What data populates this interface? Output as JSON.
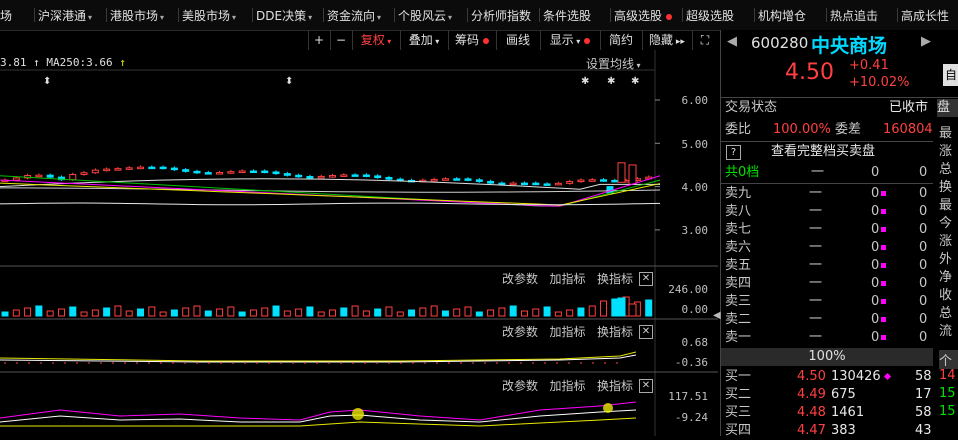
{
  "menu": [
    {
      "label": "场"
    },
    {
      "label": "沪深港通",
      "dropdown": true
    },
    {
      "label": "港股市场",
      "dropdown": true
    },
    {
      "label": "美股市场",
      "dropdown": true
    },
    {
      "label": "DDE决策",
      "dropdown": true
    },
    {
      "label": "资金流向",
      "dropdown": true
    },
    {
      "label": "个股风云",
      "dropdown": true
    },
    {
      "label": "分析师指数"
    },
    {
      "label": "条件选股"
    },
    {
      "label": "高级选股",
      "badge": true
    },
    {
      "label": "超级选股"
    },
    {
      "label": "机构增仓"
    },
    {
      "label": "热点追击"
    },
    {
      "label": "高成长性"
    }
  ],
  "toolbar": {
    "plus": "+",
    "minus": "−",
    "fuquan": "复权",
    "diejia": "叠加",
    "chouma": "筹码",
    "huaxian": "画线",
    "xianshi": "显示",
    "jianyue": "简约",
    "yincang": "隐藏",
    "expand": "⛶"
  },
  "ma_legend": {
    "ma_prefix": "3.81",
    "ma250": "MA250:3.66"
  },
  "settings_label": "设置均线",
  "price_axis": [
    "6.00",
    "5.00",
    "4.00",
    "3.00"
  ],
  "panel_tools": {
    "param": "改参数",
    "add": "加指标",
    "swap": "换指标",
    "close": "✕"
  },
  "panel_axes": [
    {
      "top": "246.00",
      "bottom": "0.00"
    },
    {
      "top": "0.68",
      "bottom": "-0.36"
    },
    {
      "top": "117.51",
      "bottom": "-9.24"
    }
  ],
  "stock": {
    "code": "600280",
    "name": "中央商场",
    "price": "4.50",
    "change": "+0.41",
    "change_pct": "+10.02%",
    "side_btn": "自"
  },
  "status": {
    "label": "交易状态",
    "value": "已收市",
    "tab": "盘口"
  },
  "ratio": {
    "wb_label": "委比",
    "wb": "100.00%",
    "wc_label": "委差",
    "wc": "160804"
  },
  "full_book": "查看完整档买卖盘",
  "total_row": {
    "label": "共0档",
    "dash": "一",
    "a": "0",
    "b": "0"
  },
  "sells": [
    {
      "label": "卖九",
      "price": "一",
      "vol": "0",
      "n": "0"
    },
    {
      "label": "卖八",
      "price": "一",
      "vol": "0",
      "n": "0"
    },
    {
      "label": "卖七",
      "price": "一",
      "vol": "0",
      "n": "0"
    },
    {
      "label": "卖六",
      "price": "一",
      "vol": "0",
      "n": "0"
    },
    {
      "label": "卖五",
      "price": "一",
      "vol": "0",
      "n": "0"
    },
    {
      "label": "卖四",
      "price": "一",
      "vol": "0",
      "n": "0"
    },
    {
      "label": "卖三",
      "price": "一",
      "vol": "0",
      "n": "0"
    },
    {
      "label": "卖二",
      "price": "一",
      "vol": "0",
      "n": "0"
    },
    {
      "label": "卖一",
      "price": "一",
      "vol": "0",
      "n": "0"
    }
  ],
  "mid_pct": "100%",
  "buys": [
    {
      "label": "买一",
      "price": "4.50",
      "vol": "130426",
      "n": "58"
    },
    {
      "label": "买二",
      "price": "4.49",
      "vol": "675",
      "n": "17"
    },
    {
      "label": "买三",
      "price": "4.48",
      "vol": "1461",
      "n": "58"
    },
    {
      "label": "买四",
      "price": "4.47",
      "vol": "383",
      "n": "43"
    }
  ],
  "tabcol": [
    "最",
    "涨",
    "总",
    "换",
    "最",
    "今",
    "涨",
    "外",
    "净",
    "收",
    "总",
    "流"
  ],
  "tabcol_bottom": {
    "label": "个",
    "vals": [
      "14",
      "15",
      "15"
    ]
  },
  "colors": {
    "up": "#ff4040",
    "down": "#00e0ff",
    "ma_white": "#e0e0e0",
    "ma_yellow": "#e8e800",
    "ma_magenta": "#ff00ff",
    "ma_green": "#00c000"
  }
}
